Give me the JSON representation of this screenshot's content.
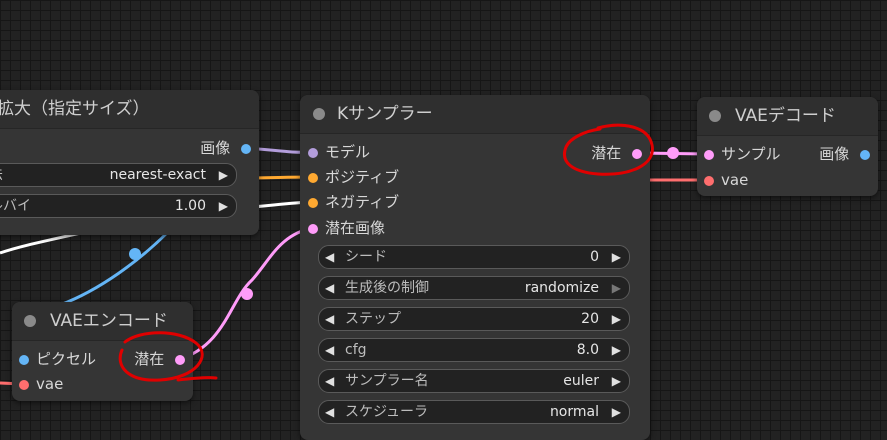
{
  "colors": {
    "model": "#b39ddb",
    "positive": "#ffa931",
    "negative": "#ffa931",
    "latent": "#ff9cf9",
    "image": "#64b5f6",
    "vae": "#ff6e6e",
    "conditioning_link": "#ffffff",
    "annotation": "#e00000"
  },
  "upscale_node": {
    "title": "拡大（指定サイズ）",
    "output_image": "画像",
    "widgets": [
      {
        "label": "法",
        "value": "nearest-exact"
      },
      {
        "label": "ルバイ",
        "value": "1.00"
      }
    ]
  },
  "ksampler_node": {
    "title": "Kサンプラー",
    "inputs": [
      "モデル",
      "ポジティブ",
      "ネガティブ",
      "潜在画像"
    ],
    "output_latent": "潜在",
    "widgets": [
      {
        "label": "シード",
        "value": "0"
      },
      {
        "label": "生成後の制御",
        "value": "randomize"
      },
      {
        "label": "ステップ",
        "value": "20"
      },
      {
        "label": "cfg",
        "value": "8.0"
      },
      {
        "label": "サンプラー名",
        "value": "euler"
      },
      {
        "label": "スケジューラ",
        "value": "normal"
      }
    ]
  },
  "vae_decode_node": {
    "title": "VAEデコード",
    "inputs": [
      "サンプル",
      "vae"
    ],
    "output_image": "画像"
  },
  "vae_encode_node": {
    "title": "VAEエンコード",
    "inputs": [
      "ピクセル",
      "vae"
    ],
    "output_latent": "潜在"
  },
  "arrows": {
    "left": "◀",
    "right": "▶"
  }
}
